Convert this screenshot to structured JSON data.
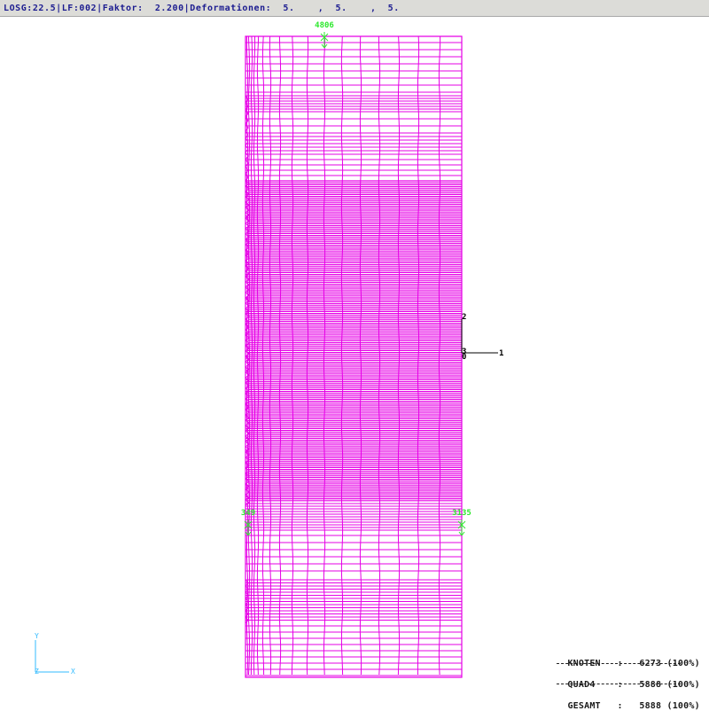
{
  "header": {
    "text": "LOSG:22.5|LF:002|Faktor:  2.200|Deformationen:  5.    ,  5.    ,  5."
  },
  "viewport": {
    "node_labels": [
      "4806",
      "349",
      "3135"
    ],
    "global_axis": {
      "label_1": "1",
      "label_2": "2",
      "label_3": "3",
      "label_0": "0"
    },
    "view_triad": {
      "label_x": "X",
      "label_y": "Y",
      "label_z": "Z"
    }
  },
  "statistics": {
    "rows": [
      {
        "label": "KNOTEN",
        "sep": ":",
        "value": "6273",
        "percent": "(100%)"
      },
      {
        "label": "QUAD4",
        "sep": ":",
        "value": "5888",
        "percent": "(100%)"
      },
      {
        "label": "GESAMT",
        "sep": ":",
        "value": "5888",
        "percent": "(100%)"
      }
    ]
  },
  "colors": {
    "mesh": "#e600e6",
    "boundary_marker": "#2ee82e",
    "axis": "#000000",
    "triad": "#33bbff",
    "header_background": "#dcdcd8",
    "header_text": "#1c1c90"
  }
}
